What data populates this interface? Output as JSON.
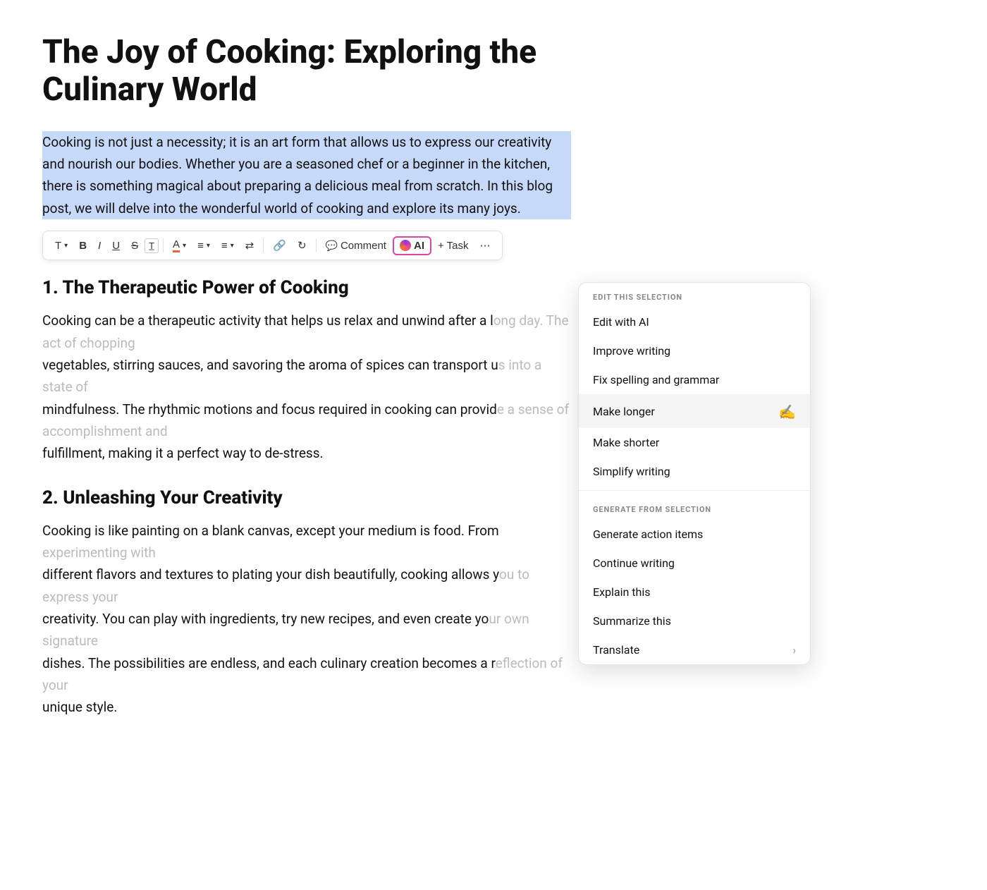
{
  "document": {
    "title": "The Joy of Cooking: Exploring the Culinary World",
    "selected_paragraph": "Cooking is not just a necessity; it is an art form that allows us to express our creativity and nourish our bodies. Whether you are a seasoned chef or a beginner in the kitchen, there is something magical about preparing a delicious meal from scratch. In this blog post, we will delve into the wonderful world of cooking and explore its many joys.",
    "sections": [
      {
        "number": "1.",
        "heading": "The Therapeutic Power of Cooking",
        "text": "Cooking can be a therapeutic activity that helps us relax and unwind after a long day. The act of chopping vegetables, stirring sauces, and savoring the aroma of spices can transport us into a state of mindfulness. The rhythmic motions and focus required in cooking can provide a sense of accomplishment and fulfillment, making it a perfect way to de-stress."
      },
      {
        "number": "2.",
        "heading": "Unleashing Your Creativity",
        "text": "Cooking is like painting on a blank canvas, except your medium is food. From experimenting with different flavors and textures to plating your dish beautifully, cooking allows you to express your creativity. You can play with ingredients, try new recipes, and even create your own signature dishes. The possibilities are endless, and each culinary creation becomes a reflection of your unique style."
      }
    ]
  },
  "toolbar": {
    "buttons": [
      {
        "id": "text",
        "label": "T",
        "has_dropdown": true
      },
      {
        "id": "bold",
        "label": "B"
      },
      {
        "id": "italic",
        "label": "I"
      },
      {
        "id": "underline",
        "label": "U"
      },
      {
        "id": "strikethrough",
        "label": "S"
      },
      {
        "id": "highlight",
        "label": "H"
      },
      {
        "id": "font-color",
        "label": "A",
        "has_dropdown": true
      },
      {
        "id": "align",
        "label": "≡",
        "has_dropdown": true
      },
      {
        "id": "list",
        "label": "≡•",
        "has_dropdown": true
      },
      {
        "id": "indent",
        "label": "⇥"
      },
      {
        "id": "link",
        "label": "🔗"
      },
      {
        "id": "undo",
        "label": "↺"
      },
      {
        "id": "comment",
        "label": "Comment"
      },
      {
        "id": "ai",
        "label": "AI"
      },
      {
        "id": "task",
        "label": "+ Task"
      },
      {
        "id": "more",
        "label": "..."
      }
    ]
  },
  "ai_dropdown": {
    "edit_section_label": "EDIT THIS SELECTION",
    "generate_section_label": "GENERATE FROM SELECTION",
    "edit_items": [
      {
        "id": "edit-with-ai",
        "label": "Edit with AI",
        "has_chevron": false
      },
      {
        "id": "improve-writing",
        "label": "Improve writing",
        "has_chevron": false
      },
      {
        "id": "fix-spelling",
        "label": "Fix spelling and grammar",
        "has_chevron": false
      },
      {
        "id": "make-longer",
        "label": "Make longer",
        "has_chevron": false,
        "hovered": true
      },
      {
        "id": "make-shorter",
        "label": "Make shorter",
        "has_chevron": false
      },
      {
        "id": "simplify-writing",
        "label": "Simplify writing",
        "has_chevron": false
      }
    ],
    "generate_items": [
      {
        "id": "generate-action-items",
        "label": "Generate action items",
        "has_chevron": false
      },
      {
        "id": "continue-writing",
        "label": "Continue writing",
        "has_chevron": false
      },
      {
        "id": "explain-this",
        "label": "Explain this",
        "has_chevron": false
      },
      {
        "id": "summarize-this",
        "label": "Summarize this",
        "has_chevron": false
      },
      {
        "id": "translate",
        "label": "Translate",
        "has_chevron": true
      }
    ]
  }
}
